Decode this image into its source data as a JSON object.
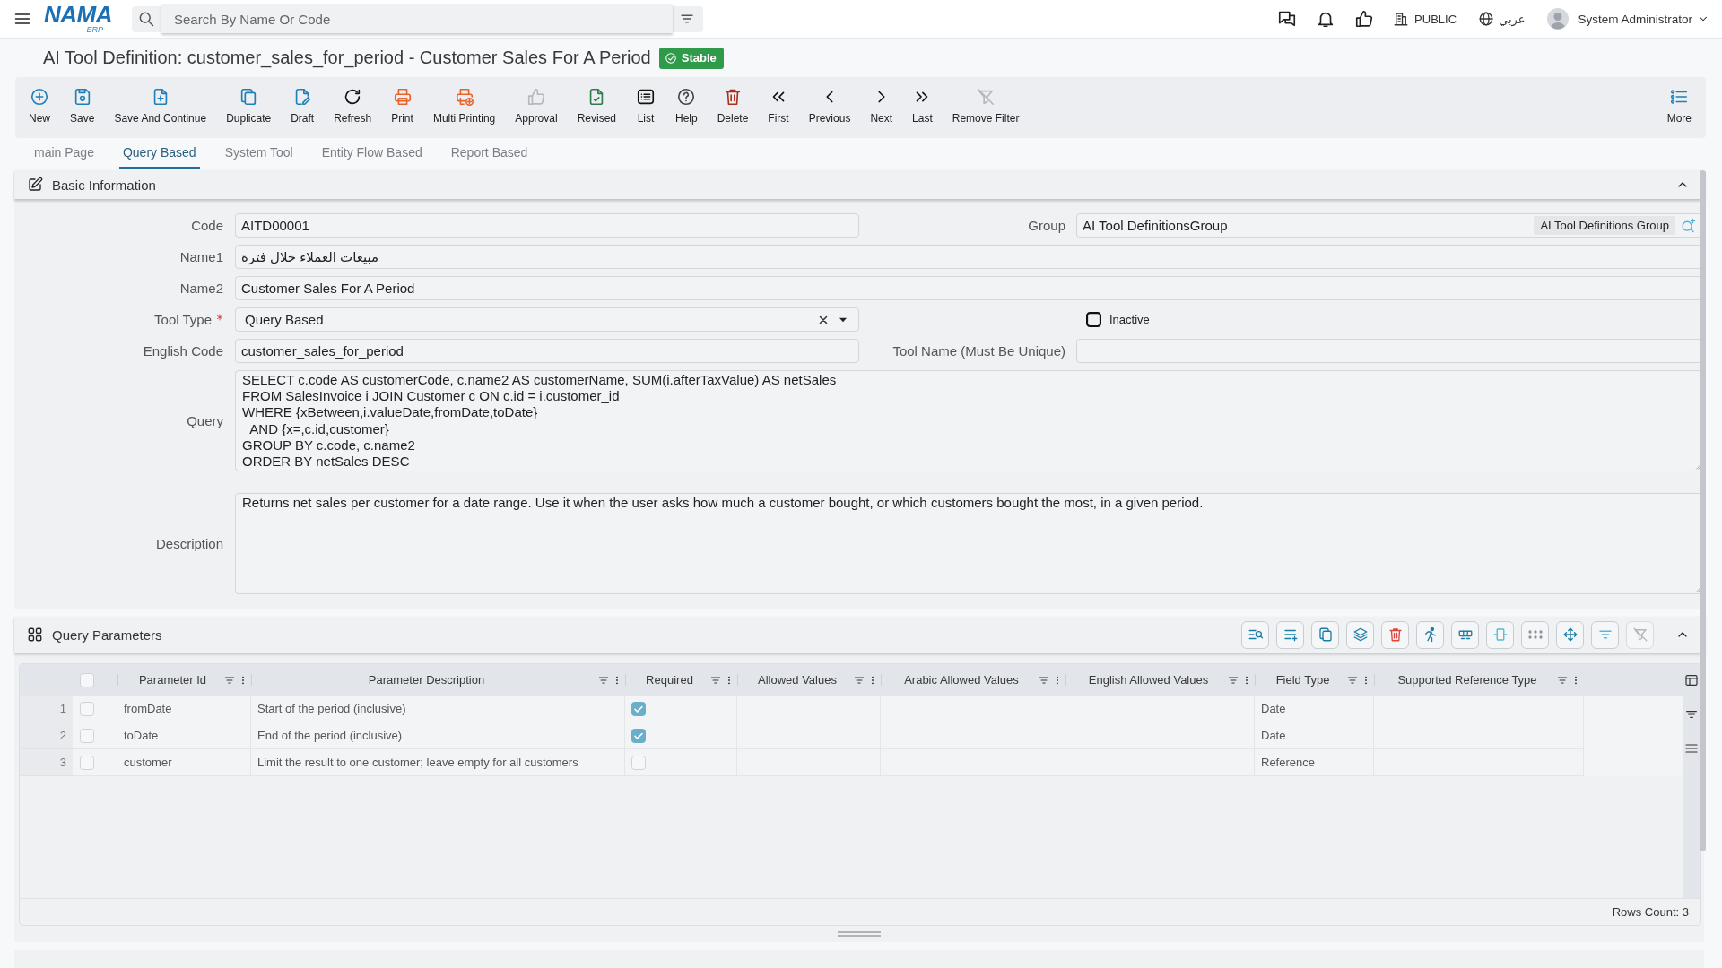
{
  "top_bar": {
    "logo": "NAMA",
    "logo_sub": "ERP",
    "search": {
      "placeholder": "Search By Name Or Code"
    },
    "scope": "PUBLIC",
    "language": "عربي",
    "user": "System Administrator"
  },
  "title": {
    "text": "AI Tool Definition: customer_sales_for_period - Customer Sales For A Period",
    "status": "Stable"
  },
  "toolbar": {
    "buttons": [
      {
        "kind": "new",
        "label": "New",
        "disabled": false
      },
      {
        "kind": "save",
        "label": "Save",
        "disabled": false
      },
      {
        "kind": "continue",
        "label": "Save And Continue",
        "disabled": false
      },
      {
        "kind": "duplicate",
        "label": "Duplicate",
        "disabled": false
      },
      {
        "kind": "draft",
        "label": "Draft",
        "disabled": false
      },
      {
        "kind": "refresh",
        "label": "Refresh",
        "disabled": false
      },
      {
        "kind": "print",
        "label": "Print",
        "disabled": false
      },
      {
        "kind": "multiprint",
        "label": "Multi Printing",
        "disabled": false
      },
      {
        "kind": "approval",
        "label": "Approval",
        "disabled": true
      },
      {
        "kind": "revised",
        "label": "Revised",
        "disabled": false
      },
      {
        "kind": "list",
        "label": "List",
        "disabled": false
      },
      {
        "kind": "help",
        "label": "Help",
        "disabled": false
      },
      {
        "kind": "delete",
        "label": "Delete",
        "disabled": false
      },
      {
        "kind": "first",
        "label": "First",
        "disabled": false
      },
      {
        "kind": "previous",
        "label": "Previous",
        "disabled": false
      },
      {
        "kind": "next",
        "label": "Next",
        "disabled": false
      },
      {
        "kind": "last",
        "label": "Last",
        "disabled": false
      },
      {
        "kind": "unfilter",
        "label": "Remove Filter",
        "disabled": true
      }
    ],
    "more": "More"
  },
  "tabs": [
    {
      "label": "main Page",
      "selected": false
    },
    {
      "label": "Query Based",
      "selected": true
    },
    {
      "label": "System Tool",
      "selected": false
    },
    {
      "label": "Entity Flow Based",
      "selected": false
    },
    {
      "label": "Report Based",
      "selected": false
    }
  ],
  "basic_information": {
    "title": "Basic Information",
    "expanded": true,
    "rows": [
      [
        {
          "kind": "text",
          "label": "Code",
          "value": "AITD00001",
          "required": false
        },
        {
          "kind": "lookup",
          "label": "Group",
          "value": "AI Tool DefinitionsGroup",
          "tag": "AI Tool Definitions Group",
          "required": false
        }
      ],
      [
        {
          "kind": "text",
          "label": "Name1",
          "value": "مبيعات العملاء خلال فترة",
          "required": false
        }
      ],
      [
        {
          "kind": "text",
          "label": "Name2",
          "value": "Customer Sales For A Period",
          "required": false
        }
      ],
      [
        {
          "kind": "select",
          "label": "Tool Type",
          "value": "Query Based",
          "required": true
        },
        {
          "kind": "checkbox",
          "label": "Inactive",
          "checked": false
        }
      ],
      [
        {
          "kind": "text",
          "label": "English Code",
          "value": "customer_sales_for_period",
          "required": false
        },
        {
          "kind": "text",
          "label": "Tool Name (Must Be Unique)",
          "required": false
        }
      ],
      [
        {
          "kind": "textarea",
          "label": "Query",
          "value": "SELECT c.code AS customerCode, c.name2 AS customerName, SUM(i.afterTaxValue) AS netSales\nFROM SalesInvoice i JOIN Customer c ON c.id = i.customer_id\nWHERE {xBetween,i.valueDate,fromDate,toDate}\n  AND {x=,c.id,customer}\nGROUP BY c.code, c.name2\nORDER BY netSales DESC",
          "required": false
        }
      ],
      [
        {
          "kind": "textarea",
          "label": "Description",
          "value": "Returns net sales per customer for a date range. Use it when the user asks how much a customer bought, or which customers bought the most, in a given period.",
          "required": false
        }
      ]
    ]
  },
  "query_parameters": {
    "title": "Query Parameters",
    "expanded": true,
    "tools": [
      {
        "kind": "find",
        "disabled": false
      },
      {
        "kind": "addrow",
        "disabled": false
      },
      {
        "kind": "copy",
        "disabled": false
      },
      {
        "kind": "layers",
        "disabled": false
      },
      {
        "kind": "delete",
        "disabled": false
      },
      {
        "kind": "run",
        "disabled": false
      },
      {
        "kind": "rows",
        "disabled": false
      },
      {
        "kind": "fit",
        "disabled": false
      },
      {
        "kind": "dots",
        "disabled": false
      },
      {
        "kind": "move",
        "disabled": false
      },
      {
        "kind": "filter",
        "disabled": false
      },
      {
        "kind": "unfilter",
        "disabled": true
      }
    ],
    "table": {
      "all_selected": false,
      "columns": [
        "Parameter Id",
        "Parameter Description",
        "Required",
        "Allowed Values",
        "Arabic Allowed Values",
        "English Allowed Values",
        "Field Type",
        "Supported Reference Type"
      ],
      "rows": [
        {
          "number": "1",
          "selected": false,
          "parameter_id": "fromDate",
          "description": "Start of the period (inclusive)",
          "required": true,
          "field_type": "Date"
        },
        {
          "number": "2",
          "selected": false,
          "parameter_id": "toDate",
          "description": "End of the period (inclusive)",
          "required": true,
          "field_type": "Date"
        },
        {
          "number": "3",
          "selected": false,
          "parameter_id": "customer",
          "description": "Limit the result to one customer; leave empty for all customers",
          "required": false,
          "field_type": "Reference"
        }
      ],
      "rows_count": "Rows Count: 3"
    }
  }
}
